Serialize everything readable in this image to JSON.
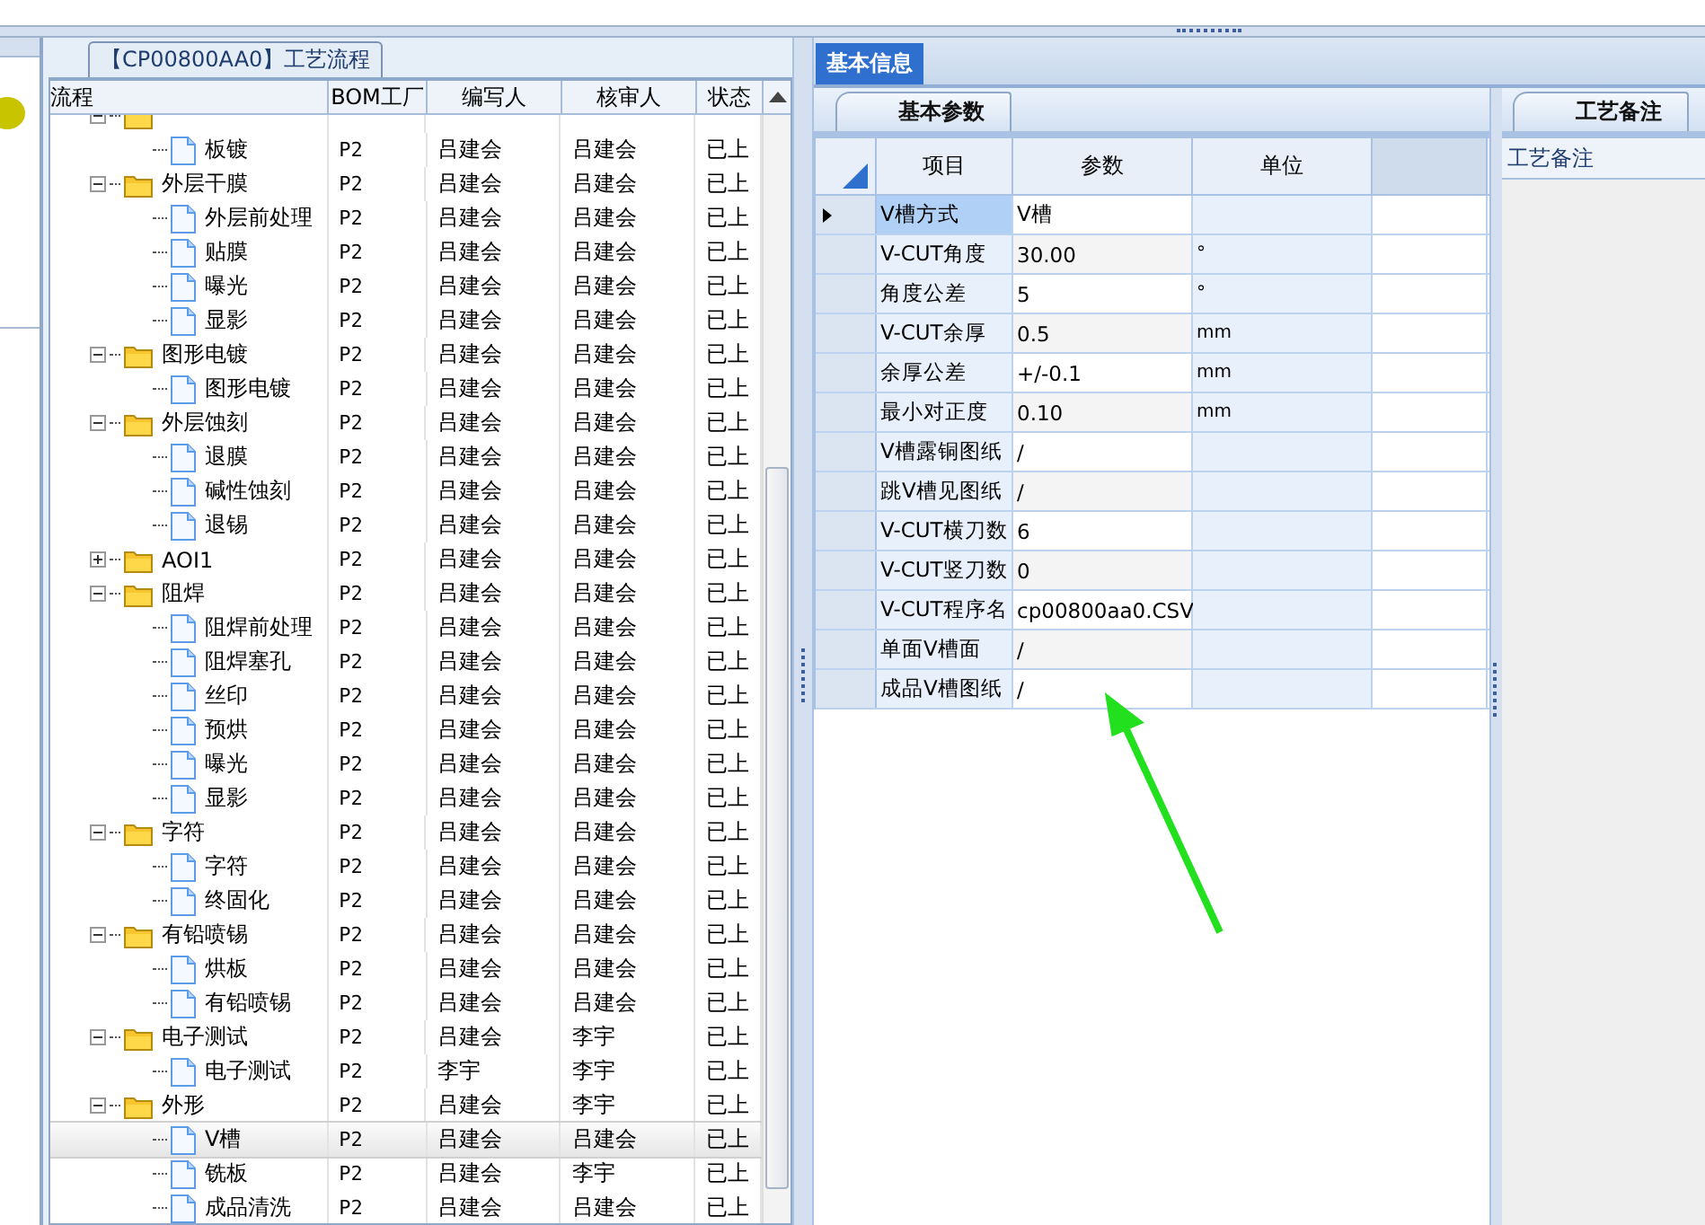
{
  "process_panel": {
    "title": "【CP00800AA0】工艺流程"
  },
  "tree": {
    "columns": [
      "流程",
      "BOM工厂",
      "编写人",
      "核审人",
      "状态"
    ],
    "rows": [
      {
        "kind": "folder",
        "expanded": true,
        "selected": false,
        "children": [
          {
            "label": "板镀",
            "kind": "file",
            "selected": false,
            "bom": "P2",
            "author": "吕建会",
            "reviewer": "吕建会",
            "status": "已上"
          }
        ]
      },
      {
        "label": "外层干膜",
        "kind": "folder",
        "expanded": true,
        "selected": false,
        "bom": "P2",
        "author": "吕建会",
        "reviewer": "吕建会",
        "status": "已上",
        "children": [
          {
            "label": "外层前处理",
            "kind": "file",
            "selected": false,
            "bom": "P2",
            "author": "吕建会",
            "reviewer": "吕建会",
            "status": "已上"
          },
          {
            "label": "贴膜",
            "kind": "file",
            "selected": false,
            "bom": "P2",
            "author": "吕建会",
            "reviewer": "吕建会",
            "status": "已上"
          },
          {
            "label": "曝光",
            "kind": "file",
            "selected": false,
            "bom": "P2",
            "author": "吕建会",
            "reviewer": "吕建会",
            "status": "已上"
          },
          {
            "label": "显影",
            "kind": "file",
            "selected": false,
            "bom": "P2",
            "author": "吕建会",
            "reviewer": "吕建会",
            "status": "已上"
          }
        ]
      },
      {
        "label": "图形电镀",
        "kind": "folder",
        "expanded": true,
        "selected": false,
        "bom": "P2",
        "author": "吕建会",
        "reviewer": "吕建会",
        "status": "已上",
        "children": [
          {
            "label": "图形电镀",
            "kind": "file",
            "selected": false,
            "bom": "P2",
            "author": "吕建会",
            "reviewer": "吕建会",
            "status": "已上"
          }
        ]
      },
      {
        "label": "外层蚀刻",
        "kind": "folder",
        "expanded": true,
        "selected": false,
        "bom": "P2",
        "author": "吕建会",
        "reviewer": "吕建会",
        "status": "已上",
        "children": [
          {
            "label": "退膜",
            "kind": "file",
            "selected": false,
            "bom": "P2",
            "author": "吕建会",
            "reviewer": "吕建会",
            "status": "已上"
          },
          {
            "label": "碱性蚀刻",
            "kind": "file",
            "selected": false,
            "bom": "P2",
            "author": "吕建会",
            "reviewer": "吕建会",
            "status": "已上"
          },
          {
            "label": "退锡",
            "kind": "file",
            "selected": false,
            "bom": "P2",
            "author": "吕建会",
            "reviewer": "吕建会",
            "status": "已上"
          }
        ]
      },
      {
        "label": "AOI1",
        "kind": "folder",
        "expanded": false,
        "selected": false,
        "bom": "P2",
        "author": "吕建会",
        "reviewer": "吕建会",
        "status": "已上"
      },
      {
        "label": "阻焊",
        "kind": "folder",
        "expanded": true,
        "selected": false,
        "bom": "P2",
        "author": "吕建会",
        "reviewer": "吕建会",
        "status": "已上",
        "children": [
          {
            "label": "阻焊前处理",
            "kind": "file",
            "selected": false,
            "bom": "P2",
            "author": "吕建会",
            "reviewer": "吕建会",
            "status": "已上"
          },
          {
            "label": "阻焊塞孔",
            "kind": "file",
            "selected": false,
            "bom": "P2",
            "author": "吕建会",
            "reviewer": "吕建会",
            "status": "已上"
          },
          {
            "label": "丝印",
            "kind": "file",
            "selected": false,
            "bom": "P2",
            "author": "吕建会",
            "reviewer": "吕建会",
            "status": "已上"
          },
          {
            "label": "预烘",
            "kind": "file",
            "selected": false,
            "bom": "P2",
            "author": "吕建会",
            "reviewer": "吕建会",
            "status": "已上"
          },
          {
            "label": "曝光",
            "kind": "file",
            "selected": false,
            "bom": "P2",
            "author": "吕建会",
            "reviewer": "吕建会",
            "status": "已上"
          },
          {
            "label": "显影",
            "kind": "file",
            "selected": false,
            "bom": "P2",
            "author": "吕建会",
            "reviewer": "吕建会",
            "status": "已上"
          }
        ]
      },
      {
        "label": "字符",
        "kind": "folder",
        "expanded": true,
        "selected": false,
        "bom": "P2",
        "author": "吕建会",
        "reviewer": "吕建会",
        "status": "已上",
        "children": [
          {
            "label": "字符",
            "kind": "file",
            "selected": false,
            "bom": "P2",
            "author": "吕建会",
            "reviewer": "吕建会",
            "status": "已上"
          },
          {
            "label": "终固化",
            "kind": "file",
            "selected": false,
            "bom": "P2",
            "author": "吕建会",
            "reviewer": "吕建会",
            "status": "已上"
          }
        ]
      },
      {
        "label": "有铅喷锡",
        "kind": "folder",
        "expanded": true,
        "selected": false,
        "bom": "P2",
        "author": "吕建会",
        "reviewer": "吕建会",
        "status": "已上",
        "children": [
          {
            "label": "烘板",
            "kind": "file",
            "selected": false,
            "bom": "P2",
            "author": "吕建会",
            "reviewer": "吕建会",
            "status": "已上"
          },
          {
            "label": "有铅喷锡",
            "kind": "file",
            "selected": false,
            "bom": "P2",
            "author": "吕建会",
            "reviewer": "吕建会",
            "status": "已上"
          }
        ]
      },
      {
        "label": "电子测试",
        "kind": "folder",
        "expanded": true,
        "selected": false,
        "bom": "P2",
        "author": "吕建会",
        "reviewer": "李宇",
        "status": "已上",
        "children": [
          {
            "label": "电子测试",
            "kind": "file",
            "selected": false,
            "bom": "P2",
            "author": "李宇",
            "reviewer": "李宇",
            "status": "已上"
          }
        ]
      },
      {
        "label": "外形",
        "kind": "folder",
        "expanded": true,
        "selected": false,
        "bom": "P2",
        "author": "吕建会",
        "reviewer": "李宇",
        "status": "已上",
        "children": [
          {
            "label": "V槽",
            "kind": "file",
            "selected": true,
            "bom": "P2",
            "author": "吕建会",
            "reviewer": "吕建会",
            "status": "已上"
          },
          {
            "label": "铣板",
            "kind": "file",
            "selected": false,
            "bom": "P2",
            "author": "吕建会",
            "reviewer": "李宇",
            "status": "已上"
          },
          {
            "label": "成品清洗",
            "kind": "file",
            "selected": false,
            "bom": "P2",
            "author": "吕建会",
            "reviewer": "吕建会",
            "status": "已上"
          }
        ]
      }
    ]
  },
  "info_tabs": [
    {
      "label": "基本信息",
      "selected": true
    }
  ],
  "params_panel": {
    "tab": "基本参数",
    "columns": [
      "项目",
      "参数",
      "单位"
    ],
    "rows": [
      {
        "item": "V槽方式",
        "value": "V槽",
        "selected": true
      },
      {
        "item": "V-CUT角度",
        "value": "30.00",
        "unit": "°",
        "selected": false
      },
      {
        "item": "角度公差",
        "value": "5",
        "unit": "°",
        "selected": false
      },
      {
        "item": "V-CUT余厚",
        "value": "0.5",
        "unit": "mm",
        "selected": false
      },
      {
        "item": "余厚公差",
        "value": "+/-0.1",
        "unit": "mm",
        "selected": false
      },
      {
        "item": "最小对正度",
        "value": "0.10",
        "unit": "mm",
        "selected": false
      },
      {
        "item": "V槽露铜图纸",
        "value": "/",
        "selected": false
      },
      {
        "item": "跳V槽见图纸",
        "value": "/",
        "selected": false
      },
      {
        "item": "V-CUT横刀数",
        "value": "6",
        "selected": false
      },
      {
        "item": "V-CUT竖刀数",
        "value": "0",
        "selected": false
      },
      {
        "item": "V-CUT程序名",
        "value": "cp00800aa0.CSV",
        "selected": false
      },
      {
        "item": "单面V槽面",
        "value": "/",
        "selected": false
      },
      {
        "item": "成品V槽图纸",
        "value": "/",
        "selected": false
      }
    ]
  },
  "notes_panel": {
    "tab": "工艺备注",
    "label": "工艺备注"
  },
  "annotation": {
    "kind": "arrow"
  }
}
